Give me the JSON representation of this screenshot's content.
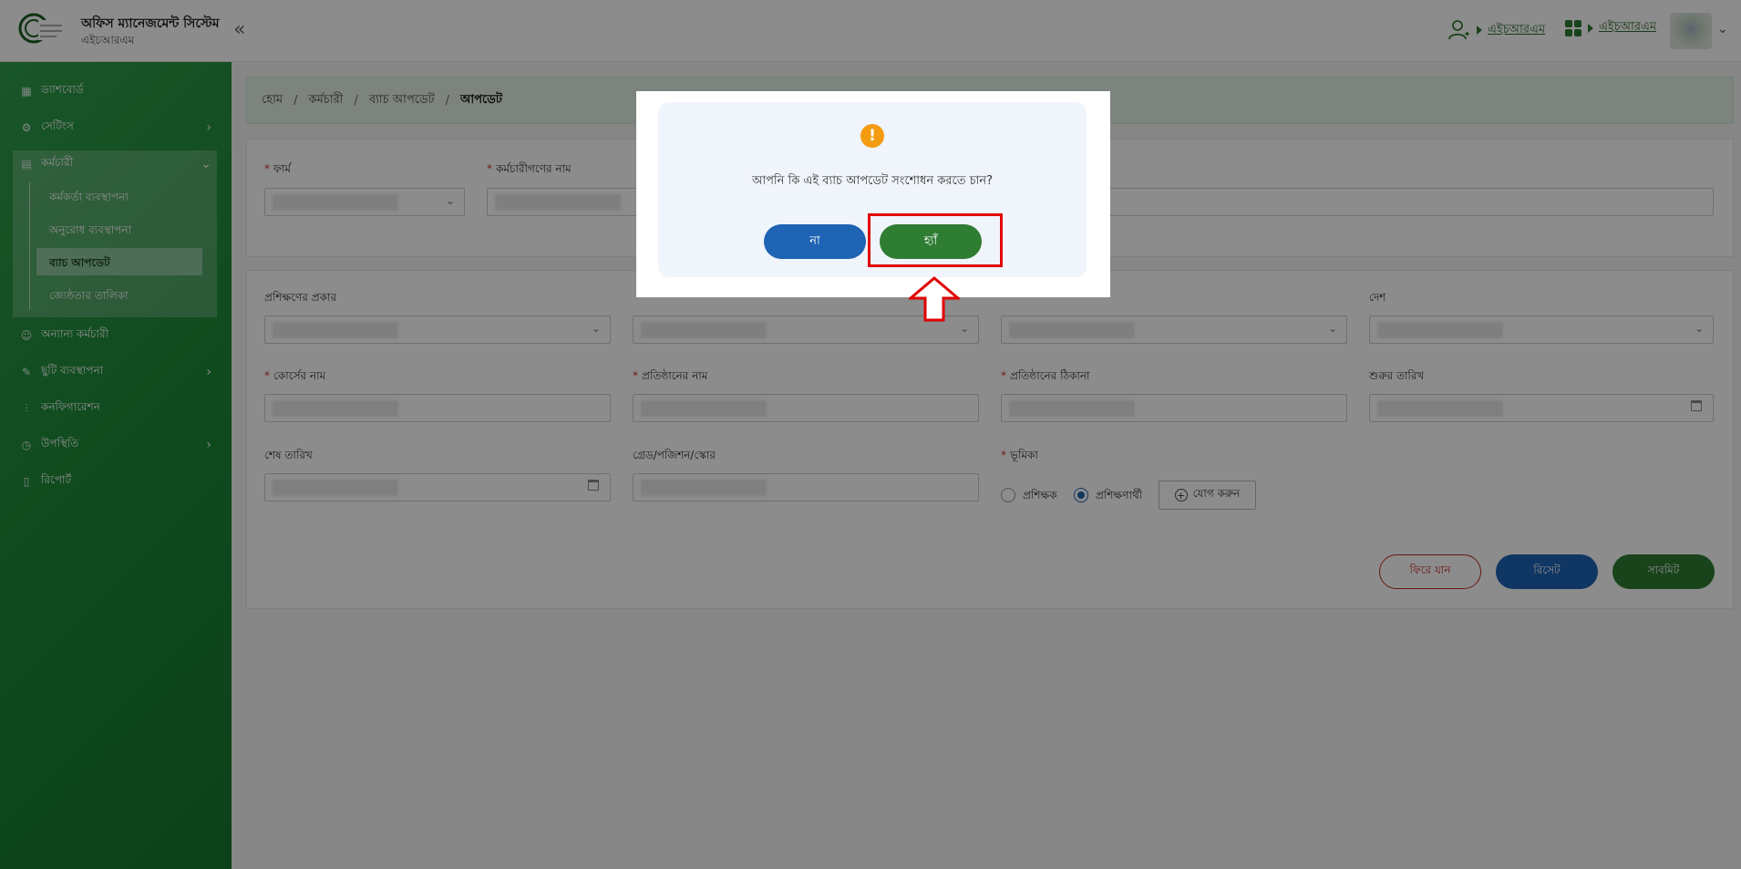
{
  "header": {
    "app_title": "অফিস ম্যানেজমেন্ট সিস্টেম",
    "app_subtitle": "এইচআরএম",
    "collapse": "«",
    "user_link": "এইচআরএম",
    "apps_link": "এইচআরএম",
    "avatar_caret": "⌄"
  },
  "sidebar": {
    "items": [
      {
        "label": "ড্যাশবোর্ড",
        "icon": "dashboard-icon"
      },
      {
        "label": "সেটিংস",
        "icon": "gear-icon"
      },
      {
        "label": "কর্মচারী",
        "icon": "users-icon"
      },
      {
        "label": "অন্যান্য কর্মচারী",
        "icon": "people-icon"
      },
      {
        "label": "ছুটি ব্যবস্থাপনা",
        "icon": "leaf-icon"
      },
      {
        "label": "কনফিগারেশন",
        "icon": "sliders-icon"
      },
      {
        "label": "উপস্থিতি",
        "icon": "clock-icon"
      },
      {
        "label": "রিপোর্ট",
        "icon": "document-icon"
      }
    ],
    "sub_items": [
      {
        "label": "কর্মকর্তা ব্যবস্থাপনা"
      },
      {
        "label": "অনুরোধ ব্যবস্থাপনা"
      },
      {
        "label": "ব্যাচ আপডেট"
      },
      {
        "label": "জ্যেষ্ঠতার তালিকা"
      }
    ]
  },
  "breadcrumb": {
    "home": "হোম",
    "employee": "কর্মচারী",
    "batch": "ব্যাচ আপডেট",
    "current": "আপডেট"
  },
  "form_top": {
    "firm_label": "ফার্ম",
    "names_label": "কর্মচারীগণের নাম"
  },
  "form_main": {
    "training_type_label": "প্রশিক্ষণের প্রকার",
    "country_label": "দেশ",
    "course_label": "কোর্সের নাম",
    "institute_label": "প্রতিষ্ঠানের নাম",
    "address_label": "প্রতিষ্ঠানের ঠিকানা",
    "start_date_label": "শুরুর তারিখ",
    "end_date_label": "শেষ তারিখ",
    "grade_label": "গ্রেড/পজিশন/স্কোর",
    "role_label": "ভূমিকা",
    "role_trainer": "প্রশিক্ষক",
    "role_trainee": "প্রশিক্ষণার্থী",
    "add_label": "যোগ করুন"
  },
  "actions": {
    "back": "ফিরে যান",
    "reset": "রিসেট",
    "submit": "সাবমিট"
  },
  "dialog": {
    "message": "আপনি কি এই ব্যাচ আপডেট সংশোধন করতে চান?",
    "no": "না",
    "yes": "হ্যাঁ",
    "warn_glyph": "!"
  },
  "colors": {
    "brand_green": "#2e7d32",
    "primary_blue": "#1e63b4",
    "danger_red": "#c62828",
    "warning_orange": "#f39c12",
    "highlight_red": "#e00000"
  }
}
